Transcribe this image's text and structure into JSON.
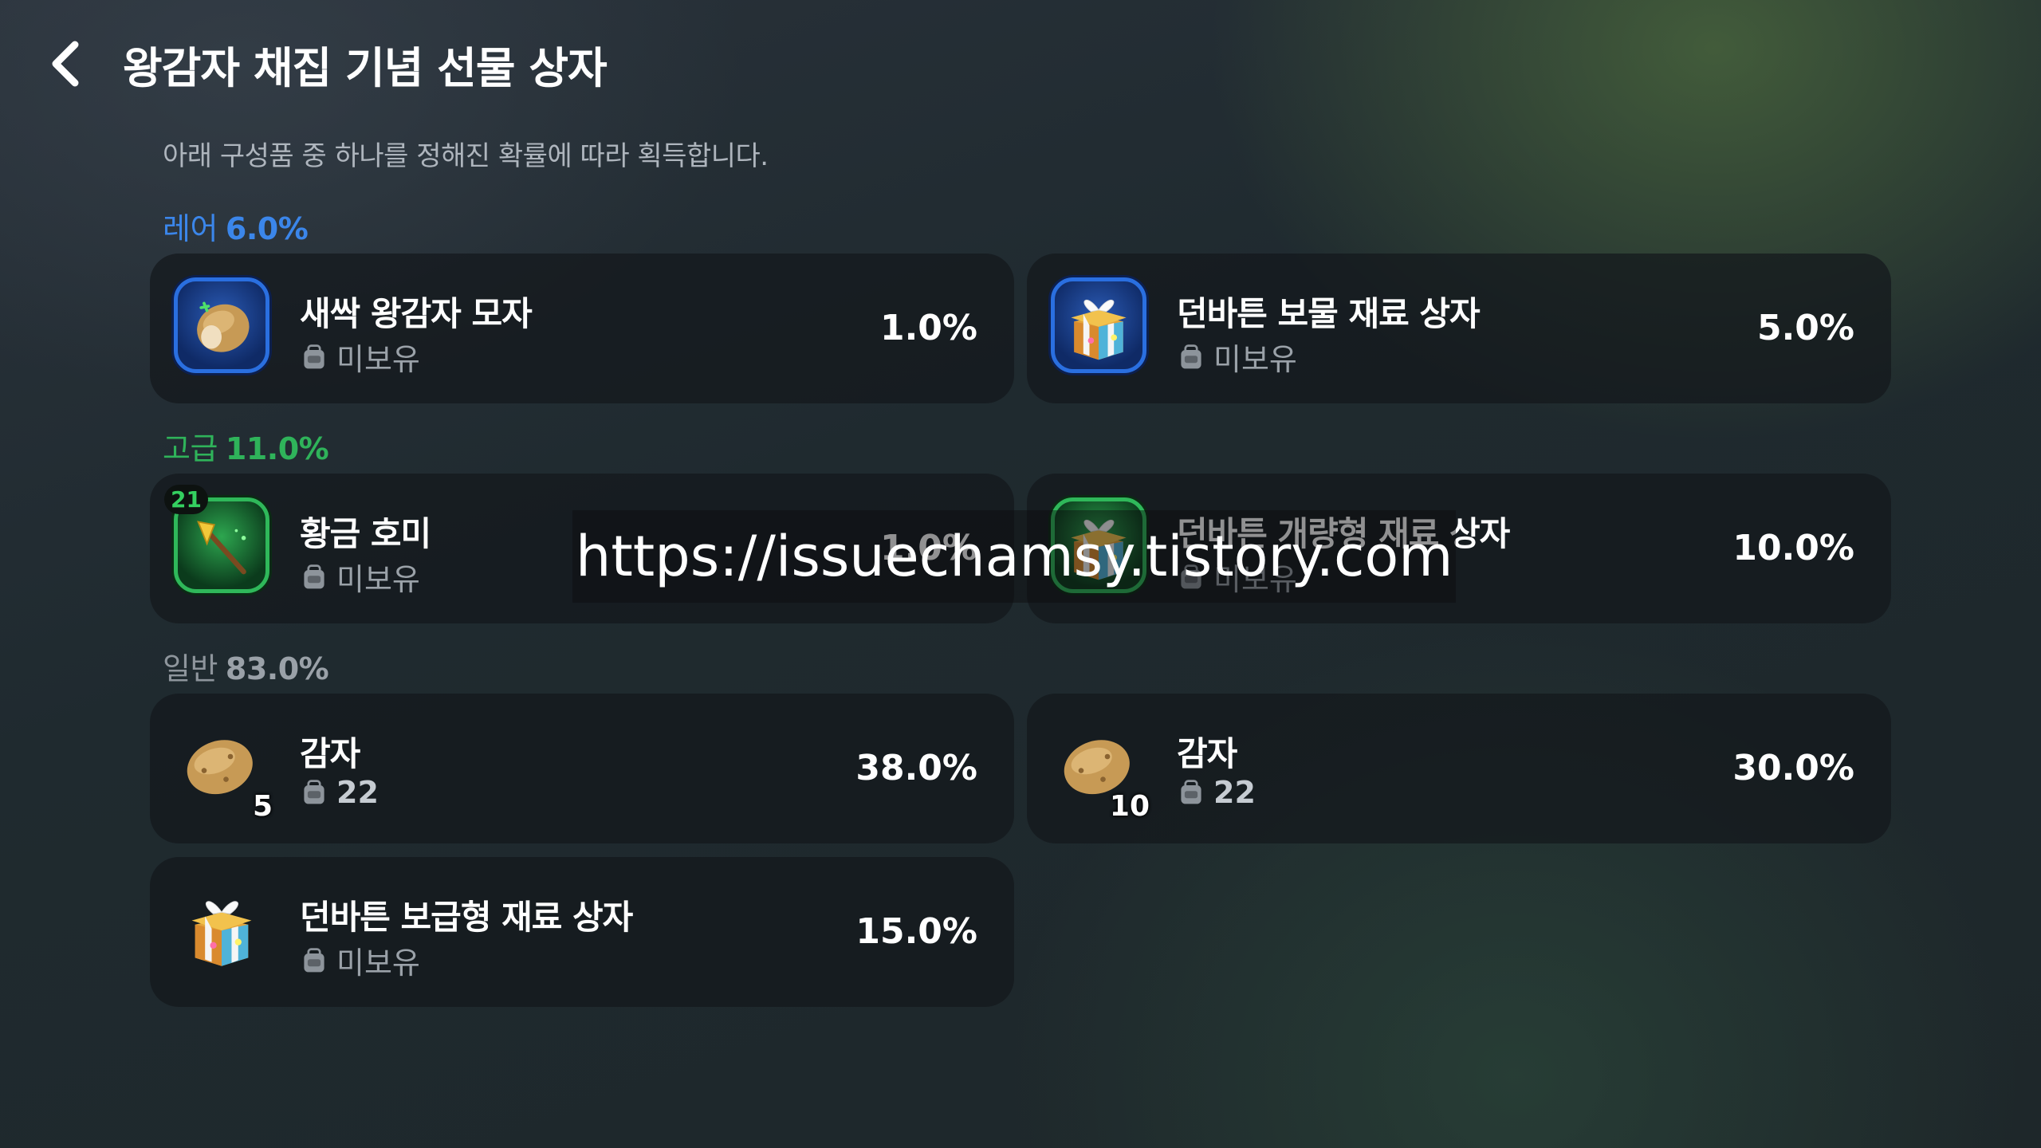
{
  "header": {
    "title": "왕감자 채집 기념 선물 상자"
  },
  "description": "아래 구성품 중 하나를 정해진 확률에 따라 획득합니다.",
  "sections": {
    "rare": {
      "label": "레어",
      "pct": "6.0%"
    },
    "advanced": {
      "label": "고급",
      "pct": "11.0%"
    },
    "normal": {
      "label": "일반",
      "pct": "83.0%"
    }
  },
  "items": {
    "sprout_hat": {
      "name": "새싹 왕감자 모자",
      "owned": "미보유",
      "prob": "1.0%"
    },
    "treasure_box": {
      "name": "던바튼 보물 재료 상자",
      "owned": "미보유",
      "prob": "5.0%"
    },
    "golden_hoe": {
      "name": "황금 호미",
      "owned": "미보유",
      "prob": "1.0%",
      "level": "21"
    },
    "improved_box": {
      "name": "던바튼 개량형 재료 상자",
      "owned": "미보유",
      "prob": "10.0%"
    },
    "potato_5": {
      "name": "감자",
      "owned": "22",
      "prob": "38.0%",
      "qty": "5"
    },
    "potato_10": {
      "name": "감자",
      "owned": "22",
      "prob": "30.0%",
      "qty": "10"
    },
    "supply_box": {
      "name": "던바튼 보급형 재료 상자",
      "owned": "미보유",
      "prob": "15.0%"
    }
  },
  "watermark": "https://issuechamsy.tistory.com",
  "colors": {
    "rare": "#3b86ea",
    "advanced": "#2fb35a",
    "normal": "#8e959c"
  },
  "icons": [
    "back-arrow-icon",
    "potato-hat-icon",
    "gift-box-icon",
    "golden-hoe-icon",
    "potato-icon",
    "bag-icon"
  ]
}
